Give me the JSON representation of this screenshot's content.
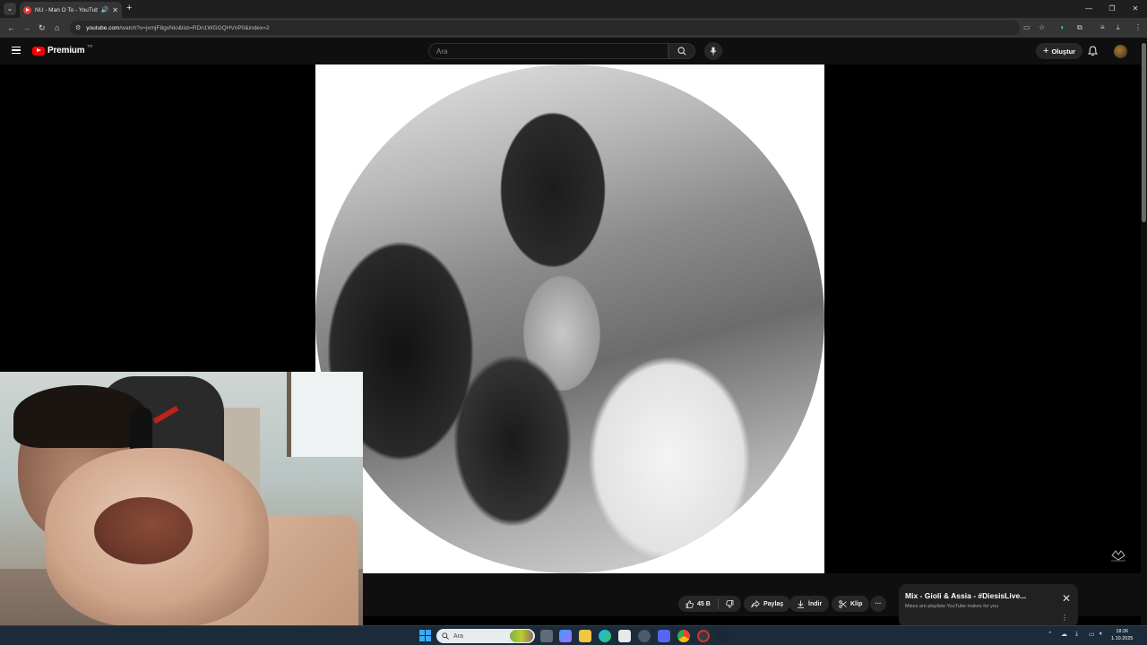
{
  "browser": {
    "tab_title": "NU - Man O To - YouTube",
    "url_prefix": "youtube.com",
    "url_rest": "/watch?v=jxmjF8gxNio&list=RDn1WGGQHVnP0&index=2"
  },
  "youtube": {
    "logo_text": "Premium",
    "region_badge": "TR",
    "search_placeholder": "Ara",
    "create_label": "Oluştur"
  },
  "actions": {
    "like_count": "45 B",
    "share_label": "Paylaş",
    "download_label": "İndir",
    "clip_label": "Klip",
    "more_label": "···"
  },
  "mix_card": {
    "title": "Mix - Gioli & Assia - #DiesisLive...",
    "subtitle": "Mixes are playlists YouTube makes for you"
  },
  "taskbar": {
    "search_label": "Ara",
    "time": "18:26",
    "date": "1.10.2025"
  },
  "colors": {
    "brand_red": "#ff0000",
    "background": "#0f0f0f",
    "pill": "#272727"
  }
}
